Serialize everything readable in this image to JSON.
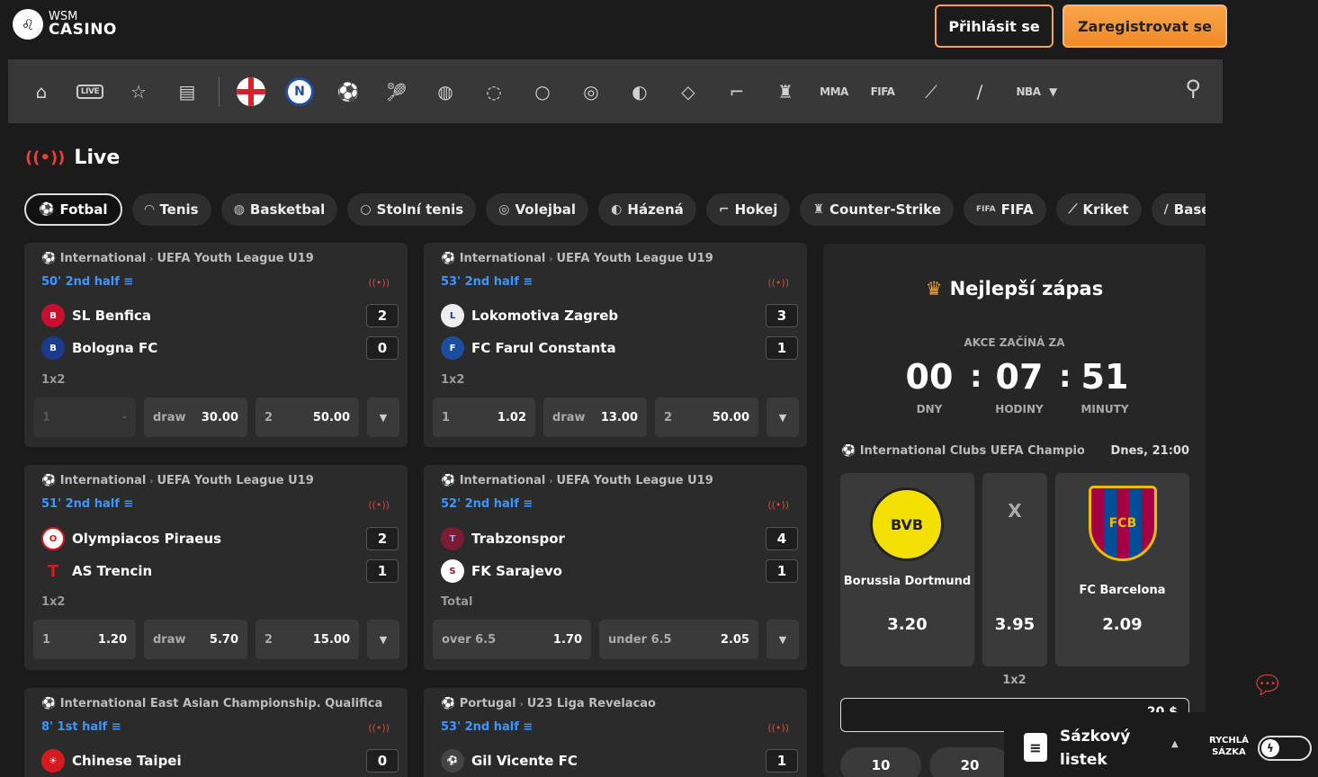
{
  "header": {
    "logo_small": "WSM",
    "logo_big": "CASINO",
    "login": "Přihlásit se",
    "register": "Zaregistrovat se"
  },
  "nav": {
    "live_badge": "LIVE",
    "mma": "MMA",
    "fifa": "FIFA",
    "nba": "NBA",
    "flag_n": "N"
  },
  "live": {
    "title": "Live"
  },
  "tabs": [
    "Fotbal",
    "Tenis",
    "Basketbal",
    "Stolní tenis",
    "Volejbal",
    "Házená",
    "Hokej",
    "Counter-Strike",
    "FIFA",
    "Kriket",
    "Base"
  ],
  "matches": [
    {
      "country": "International",
      "league": "UEFA Youth League U19",
      "time": "50' 2nd half",
      "team1": "SL Benfica",
      "score1": "2",
      "team2": "Bologna FC",
      "score2": "0",
      "market": "1x2",
      "odds": [
        {
          "k": "1",
          "v": "-"
        },
        {
          "k": "draw",
          "v": "30.00"
        },
        {
          "k": "2",
          "v": "50.00"
        }
      ]
    },
    {
      "country": "International",
      "league": "UEFA Youth League U19",
      "time": "53' 2nd half",
      "team1": "Lokomotiva Zagreb",
      "score1": "3",
      "team2": "FC Farul Constanta",
      "score2": "1",
      "market": "1x2",
      "odds": [
        {
          "k": "1",
          "v": "1.02"
        },
        {
          "k": "draw",
          "v": "13.00"
        },
        {
          "k": "2",
          "v": "50.00"
        }
      ]
    },
    {
      "country": "International",
      "league": "UEFA Youth League U19",
      "time": "51' 2nd half",
      "team1": "Olympiacos Piraeus",
      "score1": "2",
      "team2": "AS Trencin",
      "score2": "1",
      "market": "1x2",
      "odds": [
        {
          "k": "1",
          "v": "1.20"
        },
        {
          "k": "draw",
          "v": "5.70"
        },
        {
          "k": "2",
          "v": "15.00"
        }
      ]
    },
    {
      "country": "International",
      "league": "UEFA Youth League U19",
      "time": "52' 2nd half",
      "team1": "Trabzonspor",
      "score1": "4",
      "team2": "FK Sarajevo",
      "score2": "1",
      "market": "Total",
      "odds": [
        {
          "k": "over 6.5",
          "v": "1.70"
        },
        {
          "k": "under 6.5",
          "v": "2.05"
        }
      ]
    },
    {
      "country": "International",
      "league": "East Asian Championship. Qualifica",
      "time": "8' 1st half",
      "team1": "Chinese Taipei",
      "score1": "0"
    },
    {
      "country": "Portugal",
      "league": "U23 Liga Revelacao",
      "time": "53' 2nd half",
      "team1": "Gil Vicente FC",
      "score1": "1"
    }
  ],
  "best": {
    "title": "Nejlepší zápas",
    "starts": "AKCE ZAČÍNÁ ZA",
    "days": "00",
    "hours": "07",
    "minutes": "51",
    "days_label": "DNY",
    "hours_label": "HODINY",
    "minutes_label": "MINUTY",
    "league": "International Clubs UEFA Champions Le",
    "date": "Dnes, 21:00",
    "home": "Borussia Dortmund",
    "home_odd": "3.20",
    "draw": "X",
    "draw_odd": "3.95",
    "away": "FC Barcelona",
    "away_odd": "2.09",
    "market": "1x2",
    "stake": "20 $",
    "chips": [
      "10",
      "20"
    ]
  },
  "slip": {
    "title": "Sázkový listek",
    "quick": "RYCHLÁ SÁZKA"
  }
}
